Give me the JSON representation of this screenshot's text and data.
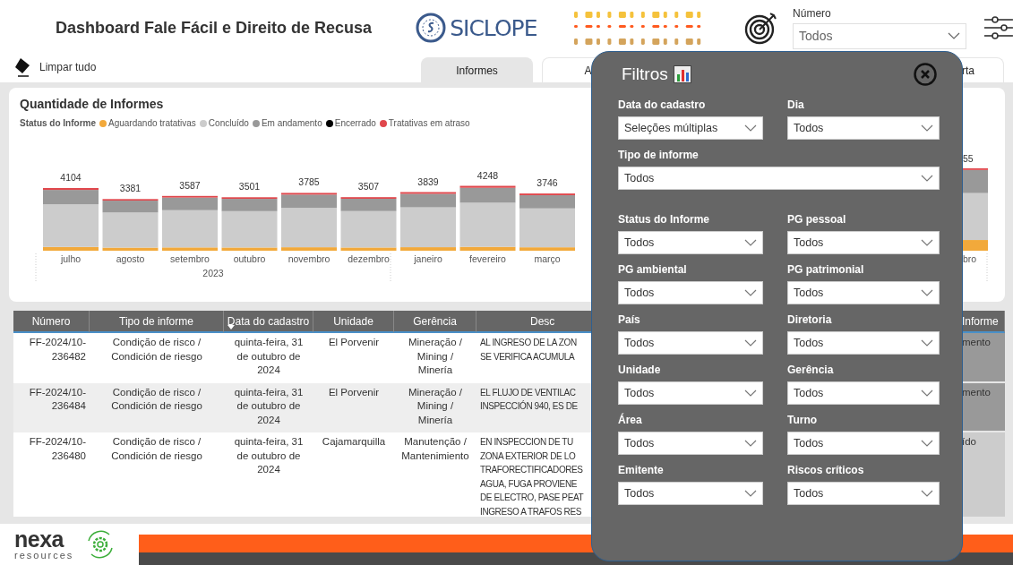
{
  "header": {
    "title": "Dashboard Fale Fácil e Direito de Recusa",
    "logo_text": "SICLOPE",
    "number_filter": {
      "label": "Número",
      "value": "Todos"
    }
  },
  "toolbar": {
    "clear_label": "Limpar tudo",
    "tabs": [
      {
        "label": "Informes",
        "selected": true
      },
      {
        "label": "A",
        "selected": false
      },
      {
        "label": "rta",
        "selected": false
      }
    ]
  },
  "chart": {
    "title": "Quantidade de Informes",
    "legend_title": "Status do Informe",
    "year_label": "2023",
    "legend": [
      {
        "name": "Aguardando tratativas",
        "color": "#f2a93b"
      },
      {
        "name": "Concluído",
        "color": "#cccccc"
      },
      {
        "name": "Em andamento",
        "color": "#999999"
      },
      {
        "name": "Encerrado",
        "color": "#000000"
      },
      {
        "name": "Tratativas em atraso",
        "color": "#e0474c"
      }
    ],
    "bars": [
      {
        "month": "julho",
        "total": "4104"
      },
      {
        "month": "agosto",
        "total": "3381"
      },
      {
        "month": "setembro",
        "total": "3587"
      },
      {
        "month": "outubro",
        "total": "3501"
      },
      {
        "month": "novembro",
        "total": "3785"
      },
      {
        "month": "dezembro",
        "total": "3507"
      },
      {
        "month": "janeiro",
        "total": "3839"
      },
      {
        "month": "fevereiro",
        "total": "4248"
      },
      {
        "month": "março",
        "total": "3746"
      }
    ],
    "cut_bar": {
      "value_label": "55",
      "category": "bro"
    }
  },
  "table": {
    "columns": [
      "Número",
      "Tipo de informe",
      "Data do cadastro",
      "Unidade",
      "Gerência",
      "Desc",
      "Informe"
    ],
    "rows": [
      {
        "numero": "FF-2024/10-\n236482",
        "tipo": "Condição de risco /\nCondición de riesgo",
        "data": "quinta-feira, 31\nde outubro de\n2024",
        "unidade": "El Porvenir",
        "gerencia": "Mineração /\nMining /\nMinería",
        "descricao": "AL INGRESO DE LA ZON\nSE VERIFICA ACUMULA",
        "status": {
          "text": "mento",
          "color": "#999999"
        }
      },
      {
        "numero": "FF-2024/10-\n236484",
        "tipo": "Condição de risco /\nCondición de riesgo",
        "data": "quinta-feira, 31\nde outubro de\n2024",
        "unidade": "El Porvenir",
        "gerencia": "Mineração /\nMining /\nMinería",
        "descricao": "EL FLUJO DE VENTILAC\nINSPECCIÓN 940, ES DE",
        "status": {
          "text": "mento",
          "color": "#999999"
        }
      },
      {
        "numero": "FF-2024/10-\n236480",
        "tipo": "Condição de risco /\nCondición de riesgo",
        "data": "quinta-feira, 31\nde outubro de\n2024",
        "unidade": "Cajamarquilla",
        "gerencia": "Manutenção /\nMantenimiento",
        "descricao": "EN INSPECCION DE TU\nZONA EXTERIOR DE LO\nTRAFORECTIFICADORES\nAGUA, FUGA PROVIENE\nDE ELECTRO, PASE PEAT\nINGRESO A TRAFOS RES",
        "status": {
          "text": "ído",
          "color": "#cccccc"
        }
      }
    ]
  },
  "footer": {
    "brand": "nexa",
    "brand_sub": "resources"
  },
  "filters_panel": {
    "title": "Filtros",
    "filters": [
      {
        "label": "Data do cadastro",
        "value": "Seleções múltiplas",
        "kind": "half"
      },
      {
        "label": "Dia",
        "value": "Todos",
        "kind": "half"
      },
      {
        "label": "Tipo de informe",
        "value": "Todos",
        "kind": "wide"
      },
      {
        "label": "Status do Informe",
        "value": "Todos",
        "kind": "half"
      },
      {
        "label": "PG pessoal",
        "value": "Todos",
        "kind": "half"
      },
      {
        "label": "PG ambiental",
        "value": "Todos",
        "kind": "half"
      },
      {
        "label": "PG patrimonial",
        "value": "Todos",
        "kind": "half"
      },
      {
        "label": "País",
        "value": "Todos",
        "kind": "half"
      },
      {
        "label": "Diretoria",
        "value": "Todos",
        "kind": "half"
      },
      {
        "label": "Unidade",
        "value": "Todos",
        "kind": "half"
      },
      {
        "label": "Gerência",
        "value": "Todos",
        "kind": "half"
      },
      {
        "label": "Área",
        "value": "Todos",
        "kind": "half"
      },
      {
        "label": "Turno",
        "value": "Todos",
        "kind": "half"
      },
      {
        "label": "Emitente",
        "value": "Todos",
        "kind": "half"
      },
      {
        "label": "Riscos críticos",
        "value": "Todos",
        "kind": "half"
      }
    ]
  }
}
